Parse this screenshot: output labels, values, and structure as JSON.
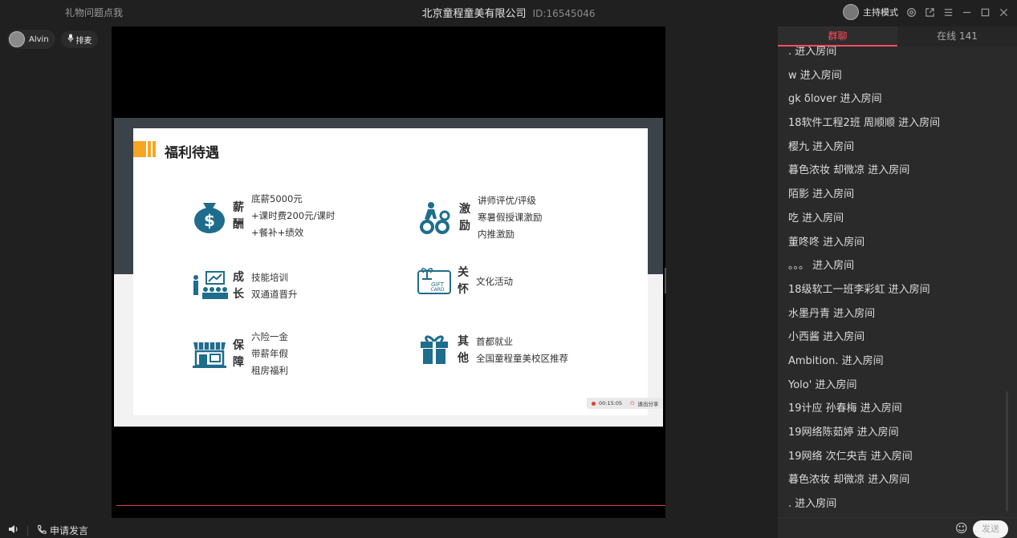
{
  "app": {
    "gift_hint": "礼物问题点我",
    "title": "北京童程童美有限公司",
    "room_id": "ID:16545046",
    "host_mode": "主持模式"
  },
  "left": {
    "user_name": "Alvin",
    "mic_label": "排麦",
    "apply_speak": "申请发言"
  },
  "slide": {
    "title": "福利待遇",
    "accent_color": "#f5a623",
    "icon_color": "#1f6d8c",
    "items": [
      {
        "cat": [
          "薪",
          "酬"
        ],
        "lines": [
          "底薪5000元",
          "+课时费200元/课时",
          "+餐补+绩效"
        ],
        "icon": "money-bag-icon"
      },
      {
        "cat": [
          "激",
          "励"
        ],
        "lines": [
          "讲师评优/评级",
          "寒暑假授课激励",
          "内推激励"
        ],
        "icon": "gears-icon"
      },
      {
        "cat": [
          "成",
          "长"
        ],
        "lines": [
          "技能培训",
          "双通道晋升"
        ],
        "icon": "presentation-icon"
      },
      {
        "cat": [
          "关",
          "怀"
        ],
        "lines": [
          "文化活动"
        ],
        "icon": "gift-card-icon"
      },
      {
        "cat": [
          "保",
          "障"
        ],
        "lines": [
          "六险一金",
          "带薪年假",
          "租房福利"
        ],
        "icon": "store-icon"
      },
      {
        "cat": [
          "其",
          "他"
        ],
        "lines": [
          "首都就业",
          "全国童程童美校区推荐"
        ],
        "icon": "gift-icon"
      }
    ],
    "rec_time": "00:15:05",
    "exit_share": "退出分享"
  },
  "chat": {
    "tab_group": "群聊",
    "tab_online": "在线 141",
    "messages": [
      ". 进入房间",
      "w 进入房间",
      "gk  δlover 进入房间",
      "18软件工程2班 周顺顺 进入房间",
      "樱九 进入房间",
      "暮色浓妆 却微凉 进入房间",
      "陌影 进入房间",
      "吃      进入房间",
      "董咚咚 进入房间",
      "。。。 进入房间",
      "18级软工一班李彩虹 进入房间",
      "水墨丹青 进入房间",
      "小西酱     进入房间",
      "Ambition.     进入房间",
      "Yolo' 进入房间",
      "19计应  孙春梅 进入房间",
      "19网络陈茹婷 进入房间",
      "19网络 次仁央吉 进入房间",
      "暮色浓妆 却微凉 进入房间",
      ". 进入房间"
    ],
    "send_label": "发送"
  }
}
